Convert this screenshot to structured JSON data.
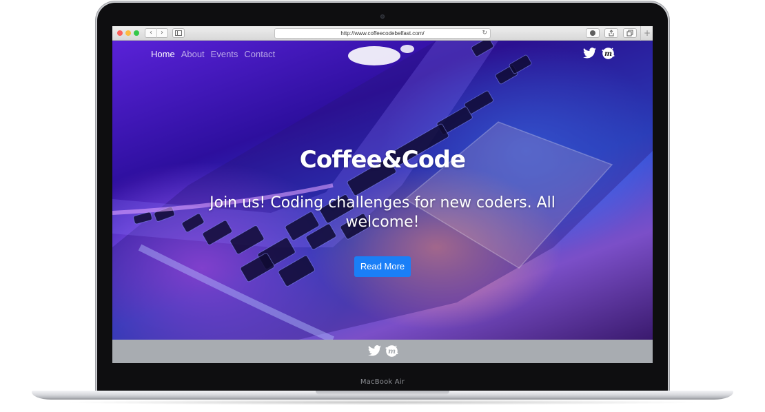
{
  "device": {
    "model_label": "MacBook Air"
  },
  "browser": {
    "url": "http://www.coffeecodebelfast.com/",
    "back_icon": "chevron-left-icon",
    "forward_icon": "chevron-right-icon",
    "reload_icon": "reload-icon"
  },
  "nav": {
    "items": [
      {
        "label": "Home",
        "active": true
      },
      {
        "label": "About",
        "active": false
      },
      {
        "label": "Events",
        "active": false
      },
      {
        "label": "Contact",
        "active": false
      }
    ]
  },
  "social": {
    "icons": [
      "twitter-icon",
      "meetup-icon"
    ]
  },
  "hero": {
    "title": "Coffee&Code",
    "subtitle": "Join us! Coding challenges for new coders. All welcome!",
    "button_label": "Read More"
  },
  "colors": {
    "button": "#1a7ff7",
    "footer": "#a8acb1",
    "hero_purple": "#5a22d8",
    "hero_blue": "#2a4fd6"
  }
}
